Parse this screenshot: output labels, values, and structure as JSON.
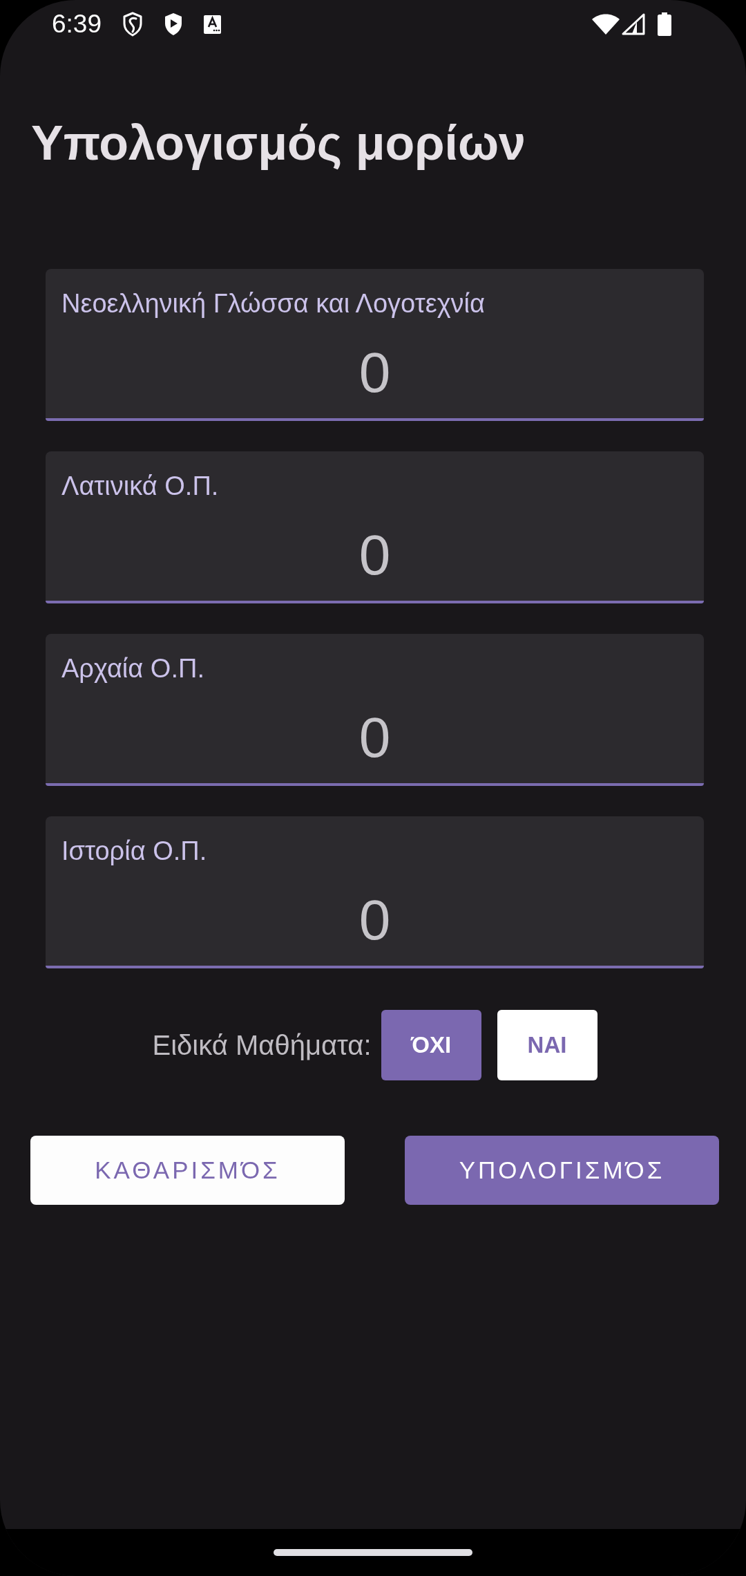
{
  "status_bar": {
    "time": "6:39"
  },
  "title": "Υπολογισμός μορίων",
  "fields": [
    {
      "label": "Νεοελληνική Γλώσσα και Λογοτεχνία",
      "value": "0"
    },
    {
      "label": "Λατινικά Ο.Π.",
      "value": "0"
    },
    {
      "label": "Αρχαία Ο.Π.",
      "value": "0"
    },
    {
      "label": "Ιστορία Ο.Π.",
      "value": "0"
    }
  ],
  "special_subjects": {
    "label": "Ειδικά Μαθήματα:",
    "options": [
      {
        "label": "ΌΧΙ",
        "selected": true
      },
      {
        "label": "ΝΑΙ",
        "selected": false
      }
    ]
  },
  "actions": [
    {
      "label": "ΚΑΘΑΡΙΣΜΌΣ",
      "kind": "secondary"
    },
    {
      "label": "ΥΠΟΛΟΓΙΣΜΌΣ",
      "kind": "primary"
    }
  ]
}
